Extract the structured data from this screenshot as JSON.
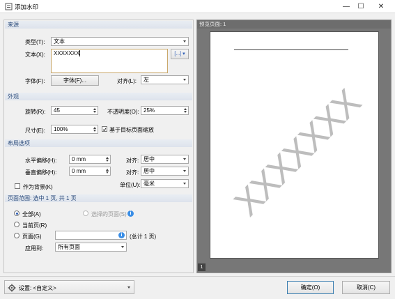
{
  "window": {
    "title": "添加水印",
    "min": "—",
    "max": "☐",
    "close": "✕"
  },
  "source": {
    "header": "来源",
    "type_label": "类型(T):",
    "type_value": "文本",
    "text_label": "文本(X):",
    "text_value": "XXXXXXX",
    "font_label": "字体(F):",
    "font_button": "字体(F)...",
    "align_label": "对齐(L):",
    "align_value": "左",
    "insert_btn": "[...]"
  },
  "appearance": {
    "header": "外观",
    "rotate_label": "旋转(R):",
    "rotate_value": "45",
    "opacity_label": "不透明度(O):",
    "opacity_value": "25%",
    "size_label": "尺寸(E):",
    "size_value": "100%",
    "scale_label": "基于目标页面缩放",
    "scale_checked": true
  },
  "layout": {
    "header": "布局选项",
    "hoffset_label": "水平偏移(H):",
    "hoffset_value": "0 mm",
    "halign_label": "对齐:",
    "halign_value": "居中",
    "voffset_label": "垂直偏移(H):",
    "voffset_value": "0 mm",
    "valign_label": "对齐:",
    "valign_value": "居中",
    "background_label": "作为背景(K)",
    "background_checked": false,
    "unit_label": "单位(U):",
    "unit_value": "毫米"
  },
  "range": {
    "header": "页面范围: 选中 1 页, 共 1 页",
    "all_label": "全部(A)",
    "selected_label": "选择的页面(S)",
    "current_label": "当前页(R)",
    "pages_label": "页面(G)",
    "pages_value": "",
    "total_text": "(总计 1 页)",
    "apply_label": "应用到:",
    "apply_value": "所有页面"
  },
  "preview": {
    "header": "预览页面: 1",
    "page_number": "1",
    "watermark": "XXXXXXX"
  },
  "footer": {
    "settings_label": "设置:  <自定义>",
    "ok": "确定(O)",
    "cancel": "取消(C)"
  },
  "colors": {
    "accent": "#2b5bb5",
    "info": "#3a8ee6",
    "watermark": "#bdbdbd"
  }
}
